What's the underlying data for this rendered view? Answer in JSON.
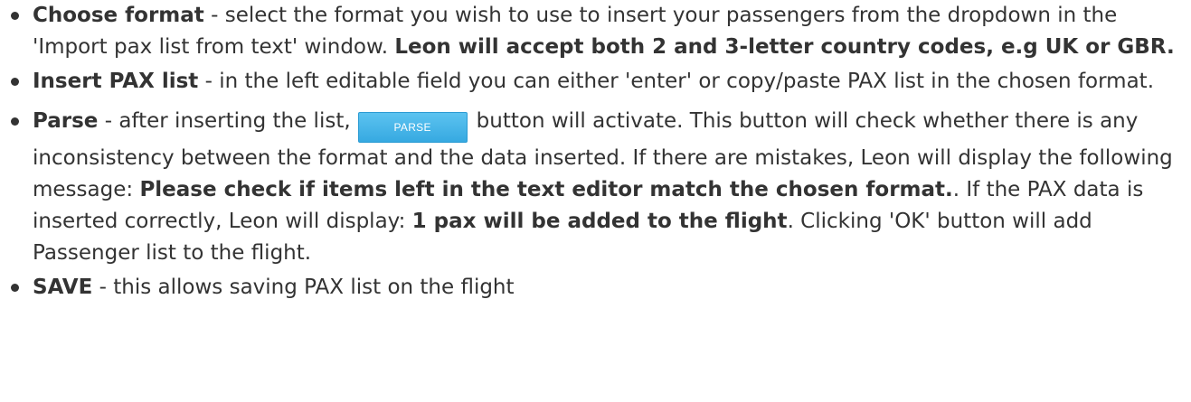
{
  "items": [
    {
      "title": "Choose format",
      "text1": " - select the format you wish to use to insert your passengers from the dropdown in the 'Import pax list from text' window. ",
      "bold2": "Leon will accept both 2 and 3-letter country codes, e.g UK or GBR."
    },
    {
      "title": "Insert PAX list",
      "text1": " - in the left editable field you can either 'enter' or copy/paste PAX list in the chosen format."
    },
    {
      "title": "Parse",
      "text1": " - after inserting the list,",
      "button_label": "PARSE",
      "text2": "button will activate. This button will check whether there is any inconsistency between the format and the data inserted. If there are mistakes, Leon will display the following message: ",
      "bold2": "Please check if items left in the text editor match the chosen format.",
      "text3": ". If the PAX data is inserted correctly, Leon will display: ",
      "bold3": "1 pax will be added to the flight",
      "text4": ". Clicking 'OK' button will add Passenger list to the flight."
    },
    {
      "title": "SAVE",
      "text1": " - this allows saving PAX list on the flight"
    }
  ]
}
